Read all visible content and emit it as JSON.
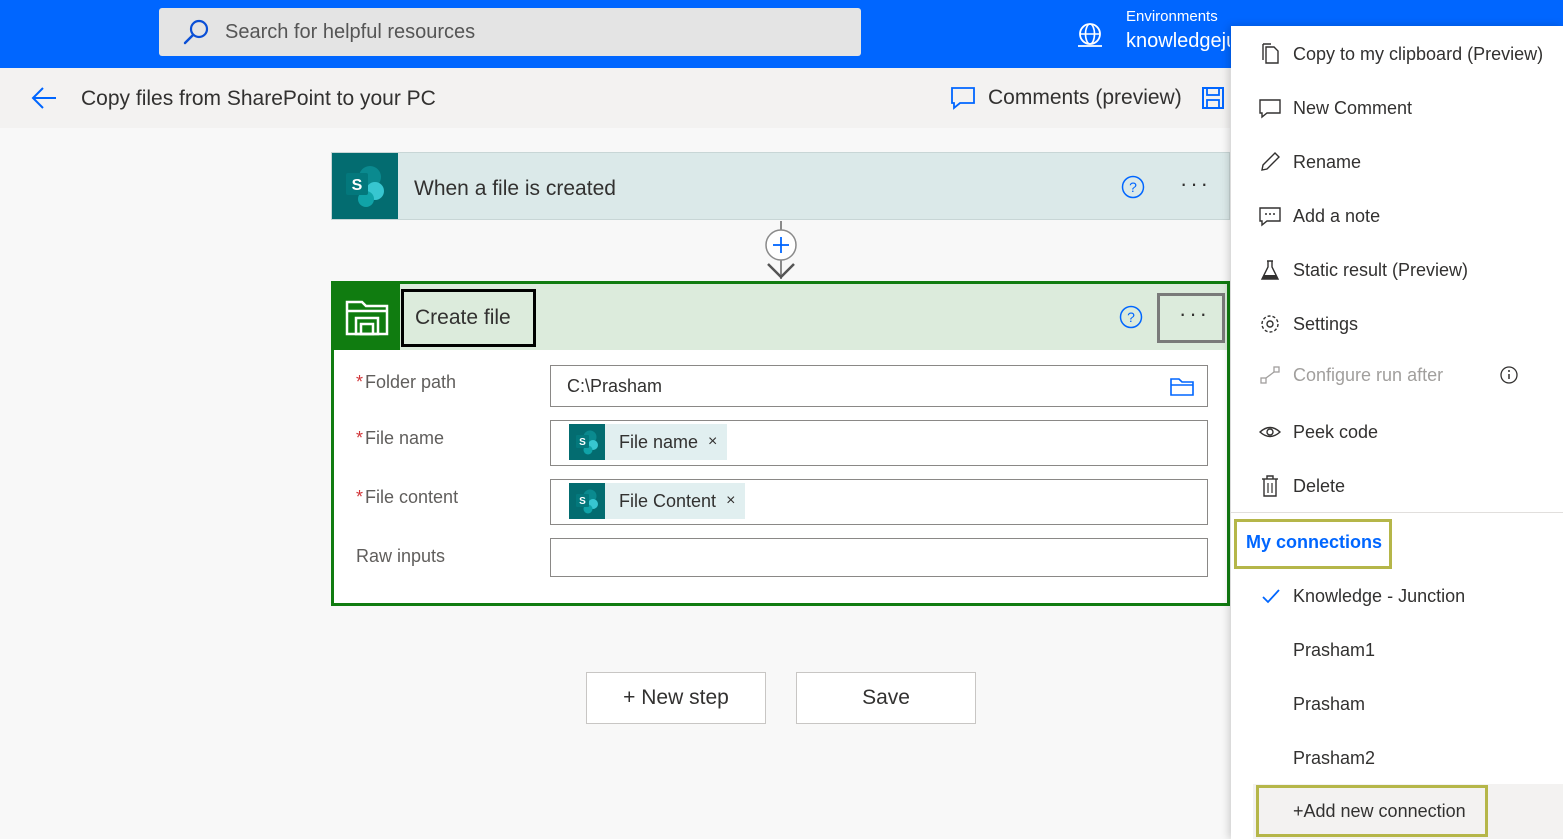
{
  "topbar": {
    "search_placeholder": "Search for helpful resources",
    "env_label": "Environments",
    "env_name": "knowledgejunction"
  },
  "cmdbar": {
    "flow_title": "Copy files from SharePoint to your PC",
    "comments_label": "Comments (preview)"
  },
  "trigger": {
    "title": "When a file is created",
    "more": "···"
  },
  "action": {
    "title": "Create file",
    "more": "···",
    "fields": [
      {
        "label": "Folder path",
        "required": "*",
        "value": "C:\\Prasham"
      },
      {
        "label": "File name",
        "required": "*",
        "token": "File name"
      },
      {
        "label": "File content",
        "required": "*",
        "token": "File Content"
      },
      {
        "label": "Raw inputs",
        "required": "",
        "value": ""
      }
    ],
    "token_remove": "×"
  },
  "buttons": {
    "new_step": "+ New step",
    "save": "Save"
  },
  "menu": {
    "items": [
      {
        "label": "Copy to my clipboard (Preview)",
        "icon": "copy-icon"
      },
      {
        "label": "New Comment",
        "icon": "comment-icon"
      },
      {
        "label": "Rename",
        "icon": "pencil-icon"
      },
      {
        "label": "Add a note",
        "icon": "note-icon"
      },
      {
        "label": "Static result (Preview)",
        "icon": "flask-icon"
      },
      {
        "label": "Settings",
        "icon": "gear-icon"
      },
      {
        "label": "Configure run after",
        "icon": "run-after-icon"
      },
      {
        "label": "Peek code",
        "icon": "eye-icon"
      },
      {
        "label": "Delete",
        "icon": "trash-icon"
      }
    ],
    "my_connections": "My connections",
    "connections": [
      "Knowledge - Junction",
      "Prasham1",
      "Prasham",
      "Prasham2"
    ],
    "add_connection": "+Add new connection"
  },
  "colors": {
    "topbar": "#0066ff",
    "sharepoint": "#036c70",
    "filesystem": "#107c10",
    "highlight": "#b5b649",
    "link": "#0066ff"
  }
}
